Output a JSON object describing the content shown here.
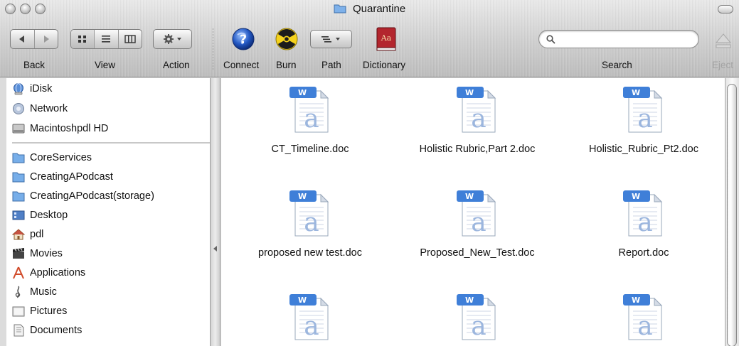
{
  "window": {
    "title": "Quarantine"
  },
  "toolbar": {
    "back_label": "Back",
    "view_label": "View",
    "action_label": "Action",
    "connect_label": "Connect",
    "burn_label": "Burn",
    "path_label": "Path",
    "dictionary_label": "Dictionary",
    "dictionary_icon_text": "Aa",
    "search_label": "Search",
    "search_value": "",
    "eject_label": "Eject"
  },
  "sidebar": {
    "devices": [
      {
        "label": "iDisk",
        "icon": "idisk-icon"
      },
      {
        "label": "Network",
        "icon": "network-icon"
      },
      {
        "label": "Macintoshpdl HD",
        "icon": "hard-drive-icon"
      }
    ],
    "places": [
      {
        "label": "CoreServices",
        "icon": "folder-icon"
      },
      {
        "label": "CreatingAPodcast",
        "icon": "folder-icon"
      },
      {
        "label": "CreatingAPodcast(storage)",
        "icon": "folder-icon"
      },
      {
        "label": "Desktop",
        "icon": "desktop-icon"
      },
      {
        "label": "pdl",
        "icon": "home-icon"
      },
      {
        "label": "Movies",
        "icon": "movies-icon"
      },
      {
        "label": "Applications",
        "icon": "applications-icon"
      },
      {
        "label": "Music",
        "icon": "music-icon"
      },
      {
        "label": "Pictures",
        "icon": "pictures-icon"
      },
      {
        "label": "Documents",
        "icon": "documents-icon"
      }
    ]
  },
  "files": [
    {
      "name": "CT_Timeline.doc"
    },
    {
      "name": "Holistic Rubric,Part 2.doc"
    },
    {
      "name": "Holistic_Rubric_Pt2.doc"
    },
    {
      "name": "proposed new test.doc"
    },
    {
      "name": "Proposed_New_Test.doc"
    },
    {
      "name": "Report.doc"
    },
    {
      "name": ""
    },
    {
      "name": ""
    },
    {
      "name": ""
    }
  ],
  "colors": {
    "folder_blue": "#6fa6e6",
    "doc_badge_blue": "#3f7fd8",
    "doc_letter": "#9cb6de"
  }
}
